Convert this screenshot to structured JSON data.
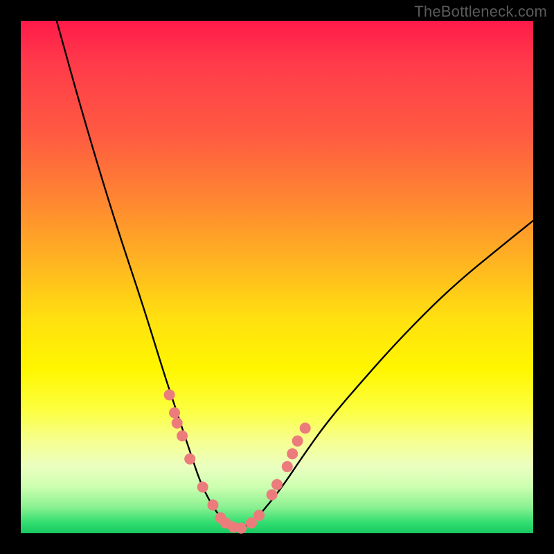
{
  "watermark": "TheBottleneck.com",
  "chart_data": {
    "type": "line",
    "title": "",
    "xlabel": "",
    "ylabel": "",
    "xlim": [
      0,
      1
    ],
    "ylim": [
      0,
      1
    ],
    "legend": false,
    "grid": false,
    "series": [
      {
        "name": "bottleneck-curve",
        "x": [
          0.07,
          0.12,
          0.18,
          0.24,
          0.28,
          0.31,
          0.33,
          0.35,
          0.37,
          0.39,
          0.41,
          0.43,
          0.45,
          0.47,
          0.51,
          0.55,
          0.6,
          0.66,
          0.74,
          0.84,
          0.95,
          1.0
        ],
        "y": [
          1.0,
          0.82,
          0.62,
          0.44,
          0.31,
          0.22,
          0.16,
          0.1,
          0.06,
          0.03,
          0.01,
          0.01,
          0.02,
          0.04,
          0.09,
          0.15,
          0.22,
          0.29,
          0.38,
          0.48,
          0.57,
          0.61
        ]
      }
    ],
    "markers": {
      "name": "highlight-dots",
      "color": "#ec7c7c",
      "x": [
        0.29,
        0.3,
        0.305,
        0.315,
        0.33,
        0.355,
        0.375,
        0.39,
        0.4,
        0.415,
        0.43,
        0.45,
        0.465,
        0.49,
        0.5,
        0.52,
        0.53,
        0.54,
        0.555
      ],
      "y": [
        0.27,
        0.235,
        0.215,
        0.19,
        0.145,
        0.09,
        0.055,
        0.03,
        0.02,
        0.012,
        0.01,
        0.02,
        0.035,
        0.075,
        0.095,
        0.13,
        0.155,
        0.18,
        0.205
      ]
    },
    "background_gradient": {
      "top": "#ff1a4a",
      "mid": "#fff600",
      "bottom": "#18c860"
    }
  }
}
